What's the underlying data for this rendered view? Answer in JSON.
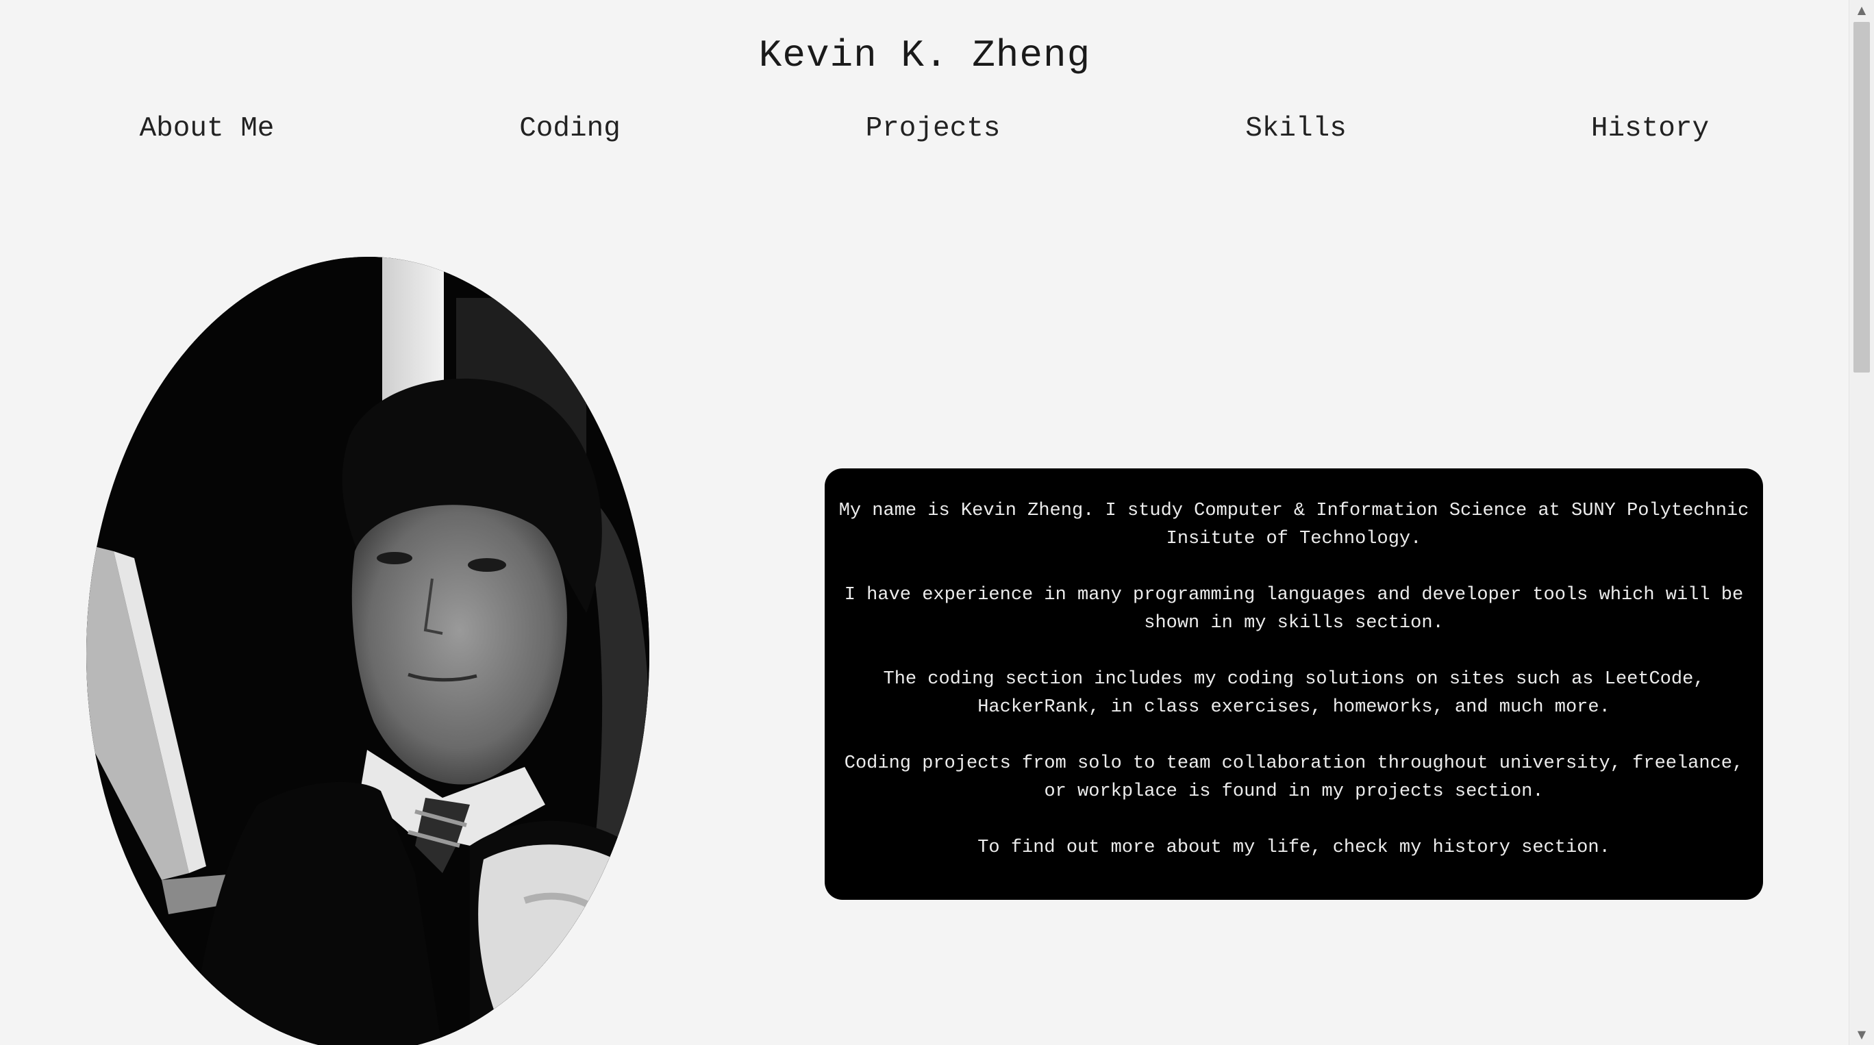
{
  "header": {
    "title": "Kevin K. Zheng"
  },
  "nav": {
    "items": [
      {
        "label": "About Me"
      },
      {
        "label": "Coding"
      },
      {
        "label": "Projects"
      },
      {
        "label": "Skills"
      },
      {
        "label": "History"
      }
    ]
  },
  "about": {
    "paragraphs": [
      "My name is Kevin Zheng. I study Computer & Information Science at SUNY Polytechnic Insitute of Technology.",
      "I have experience in many programming languages and developer tools which will be shown in my skills section.",
      "The coding section includes my coding solutions on sites such as LeetCode, HackerRank, in class exercises, homeworks, and much more.",
      "Coding projects from solo to team collaboration throughout university, freelance, or workplace is found in my projects section.",
      "To find out more about my life, check my history section."
    ]
  },
  "colors": {
    "page_background": "#f4f4f4",
    "card_background": "#000000",
    "card_text": "#ececec"
  },
  "icons": {
    "scroll_up": "triangle-up-icon",
    "scroll_down": "triangle-down-icon"
  }
}
